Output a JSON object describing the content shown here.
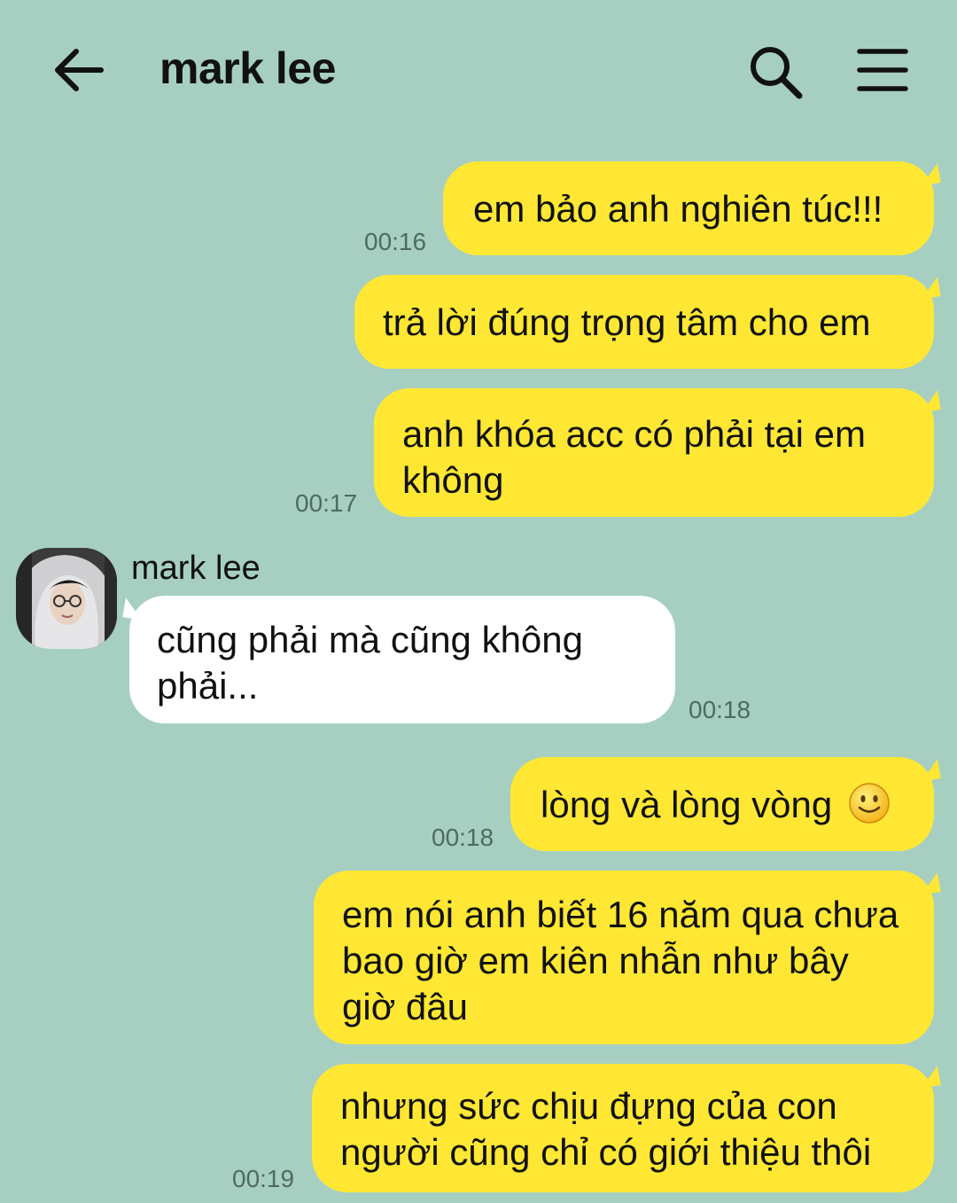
{
  "header": {
    "title": "mark lee",
    "back_icon": "arrow-left-icon",
    "search_icon": "search-icon",
    "menu_icon": "hamburger-menu-icon"
  },
  "contact": {
    "name": "mark lee",
    "avatar_icon": "profile-photo"
  },
  "messages": [
    {
      "direction": "outgoing",
      "text": "em bảo anh nghiên túc!!!",
      "time": "00:16"
    },
    {
      "direction": "outgoing",
      "text": "trả lời đúng trọng tâm cho em",
      "time": ""
    },
    {
      "direction": "outgoing",
      "text": "anh khóa acc có phải tại em không",
      "time": "00:17"
    },
    {
      "direction": "incoming",
      "text": "cũng phải mà cũng không phải...",
      "time": "00:18"
    },
    {
      "direction": "outgoing",
      "text": "lòng và lòng vòng",
      "emoji": "smiling-face-emoji",
      "time": "00:18"
    },
    {
      "direction": "outgoing",
      "text": "em nói anh biết 16 năm qua chưa bao giờ em kiên nhẫn như bây giờ đâu",
      "time": ""
    },
    {
      "direction": "outgoing",
      "text": "nhưng sức chịu đựng của con người cũng chỉ có giới thiệu thôi",
      "time": "00:19"
    }
  ],
  "colors": {
    "background": "#a6cfc2",
    "outgoing_bubble": "#ffe733",
    "incoming_bubble": "#ffffff",
    "timestamp": "#4f6a62"
  }
}
